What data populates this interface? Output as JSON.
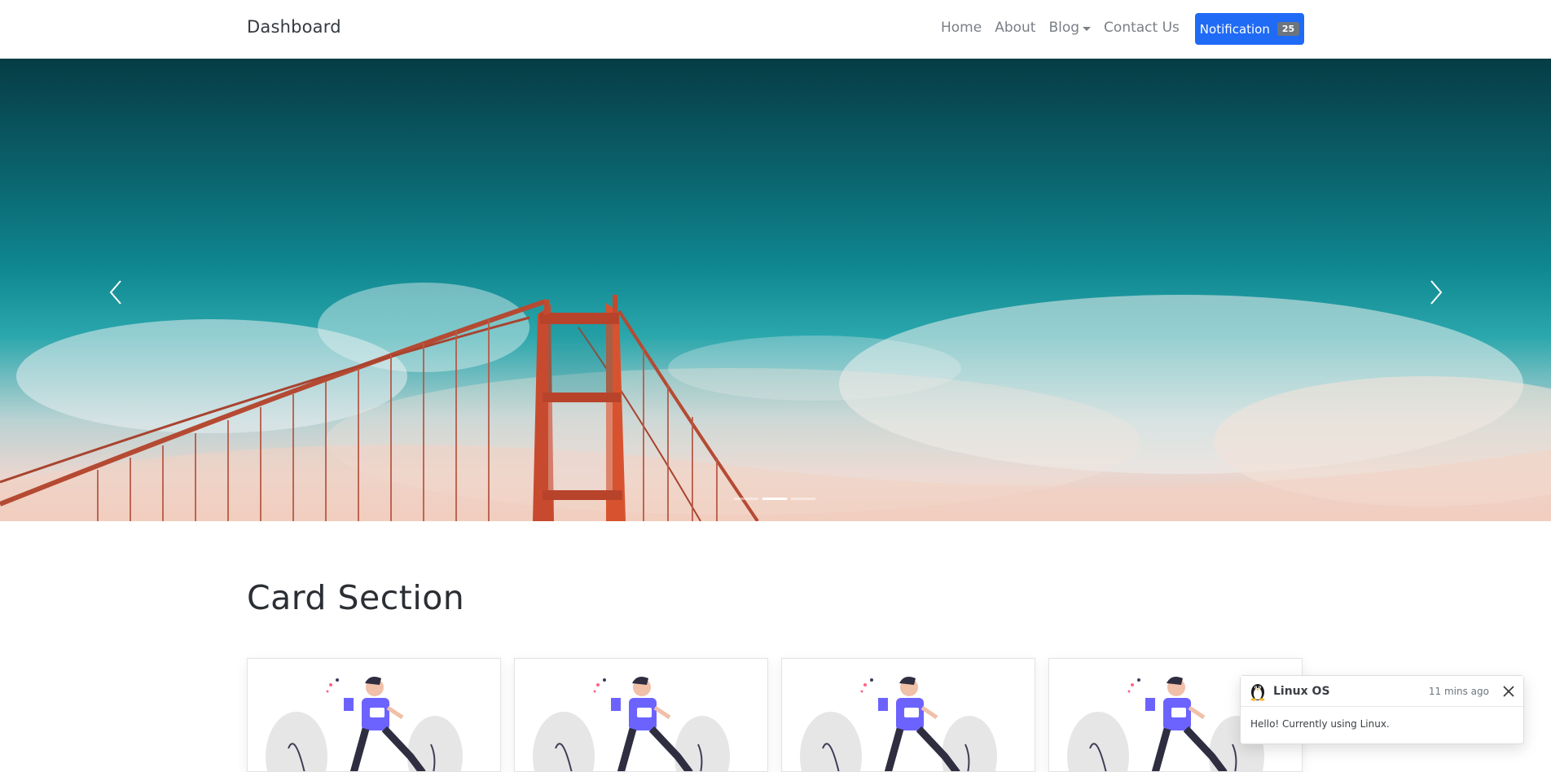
{
  "navbar": {
    "brand": "Dashboard",
    "links": [
      "Home",
      "About",
      "Blog",
      "Contact Us"
    ],
    "notification_label": "Notification",
    "notification_count": "25"
  },
  "carousel": {
    "slides": 3,
    "active_index": 1,
    "prev_icon": "chevron-left-icon",
    "next_icon": "chevron-right-icon"
  },
  "section": {
    "title": "Card Section"
  },
  "cards": [
    {
      "illustration": "runner-illustration"
    },
    {
      "illustration": "runner-illustration"
    },
    {
      "illustration": "runner-illustration"
    },
    {
      "illustration": "runner-illustration"
    }
  ],
  "toast": {
    "icon": "linux-tux-icon",
    "title": "Linux OS",
    "time": "11 mins ago",
    "body": "Hello! Currently using Linux."
  },
  "colors": {
    "primary": "#1f6bf5",
    "badge": "#6c757d",
    "text": "#212529"
  }
}
